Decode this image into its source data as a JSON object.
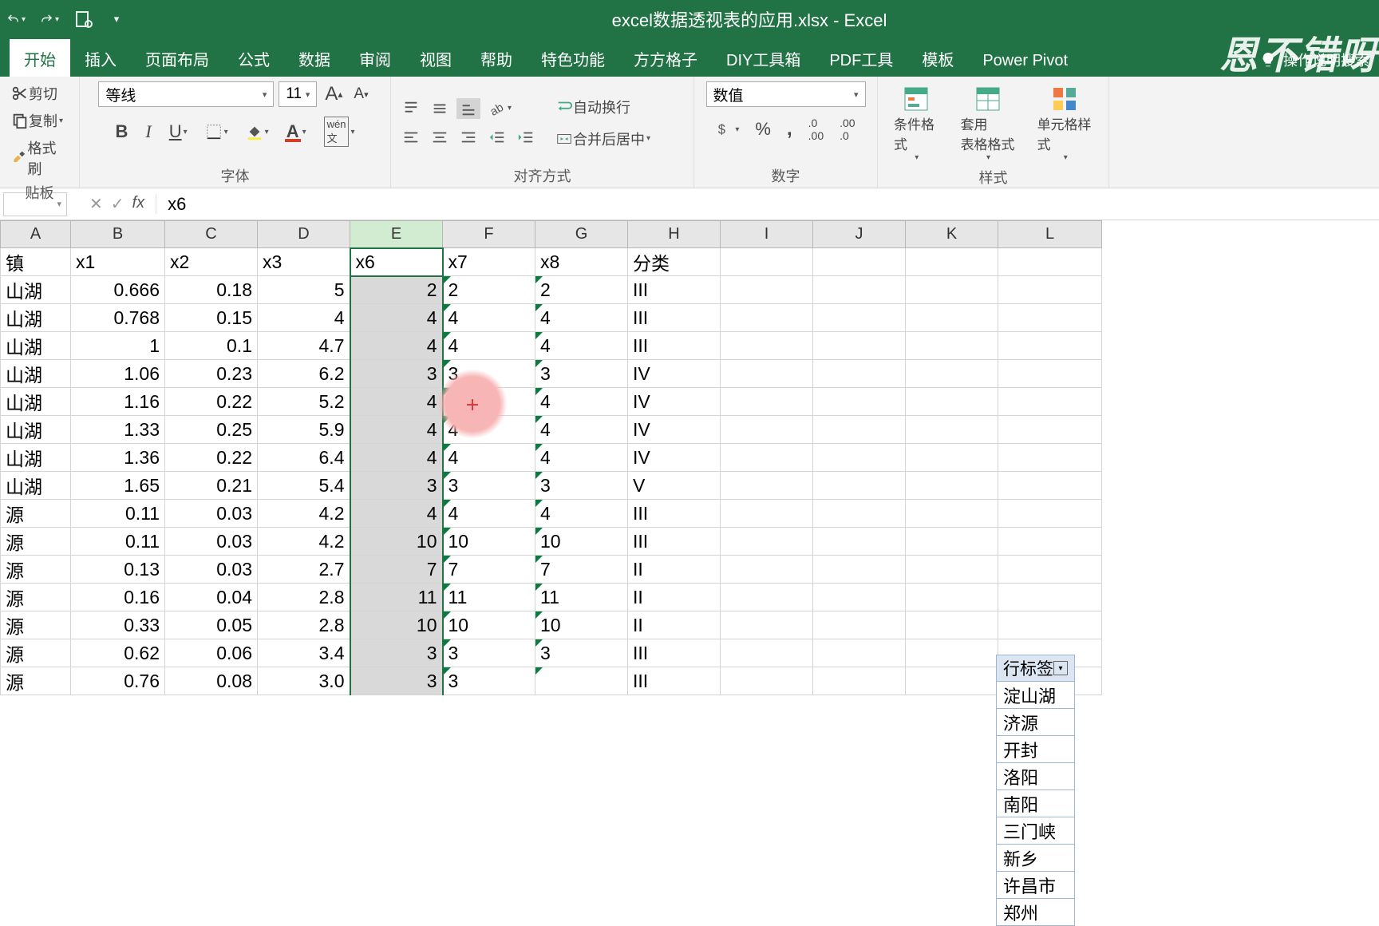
{
  "titlebar": {
    "title": "excel数据透视表的应用.xlsx - Excel"
  },
  "watermark": "恩不错呀",
  "tabs": [
    "开始",
    "插入",
    "页面布局",
    "公式",
    "数据",
    "审阅",
    "视图",
    "帮助",
    "特色功能",
    "方方格子",
    "DIY工具箱",
    "PDF工具",
    "模板",
    "Power Pivot"
  ],
  "tellme": "操作说明搜索",
  "ribbon": {
    "clipboard": {
      "label": "贴板",
      "cut": "剪切",
      "copy": "复制",
      "painter": "格式刷"
    },
    "font": {
      "label": "字体",
      "name": "等线",
      "size": "11"
    },
    "align": {
      "label": "对齐方式",
      "wrap": "自动换行",
      "merge": "合并后居中"
    },
    "number": {
      "label": "数字",
      "format": "数值"
    },
    "styles": {
      "label": "样式",
      "cond": "条件格式",
      "table": "套用\n表格格式",
      "cell": "单元格样式"
    }
  },
  "fx": {
    "value": "x6"
  },
  "columns": [
    "A",
    "B",
    "C",
    "D",
    "E",
    "F",
    "G",
    "H",
    "I",
    "J",
    "K",
    "L"
  ],
  "headerRow": {
    "A": "镇",
    "B": "x1",
    "C": "x2",
    "D": "x3",
    "E": "x6",
    "F": "x7",
    "G": "x8",
    "H": "分类"
  },
  "rows": [
    {
      "A": "山湖",
      "B": "0.666",
      "C": "0.18",
      "D": "5",
      "E": "2",
      "F": "2",
      "G": "2",
      "H": "III"
    },
    {
      "A": "山湖",
      "B": "0.768",
      "C": "0.15",
      "D": "4",
      "E": "4",
      "F": "4",
      "G": "4",
      "H": "III"
    },
    {
      "A": "山湖",
      "B": "1",
      "C": "0.1",
      "D": "4.7",
      "E": "4",
      "F": "4",
      "G": "4",
      "H": "III"
    },
    {
      "A": "山湖",
      "B": "1.06",
      "C": "0.23",
      "D": "6.2",
      "E": "3",
      "F": "3",
      "G": "3",
      "H": "IV"
    },
    {
      "A": "山湖",
      "B": "1.16",
      "C": "0.22",
      "D": "5.2",
      "E": "4",
      "F": "4",
      "G": "4",
      "H": "IV"
    },
    {
      "A": "山湖",
      "B": "1.33",
      "C": "0.25",
      "D": "5.9",
      "E": "4",
      "F": "4",
      "G": "4",
      "H": "IV"
    },
    {
      "A": "山湖",
      "B": "1.36",
      "C": "0.22",
      "D": "6.4",
      "E": "4",
      "F": "4",
      "G": "4",
      "H": "IV"
    },
    {
      "A": "山湖",
      "B": "1.65",
      "C": "0.21",
      "D": "5.4",
      "E": "3",
      "F": "3",
      "G": "3",
      "H": "V"
    },
    {
      "A": "源",
      "B": "0.11",
      "C": "0.03",
      "D": "4.2",
      "E": "4",
      "F": "4",
      "G": "4",
      "H": "III"
    },
    {
      "A": "源",
      "B": "0.11",
      "C": "0.03",
      "D": "4.2",
      "E": "10",
      "F": "10",
      "G": "10",
      "H": "III"
    },
    {
      "A": "源",
      "B": "0.13",
      "C": "0.03",
      "D": "2.7",
      "E": "7",
      "F": "7",
      "G": "7",
      "H": "II"
    },
    {
      "A": "源",
      "B": "0.16",
      "C": "0.04",
      "D": "2.8",
      "E": "11",
      "F": "11",
      "G": "11",
      "H": "II"
    },
    {
      "A": "源",
      "B": "0.33",
      "C": "0.05",
      "D": "2.8",
      "E": "10",
      "F": "10",
      "G": "10",
      "H": "II"
    },
    {
      "A": "源",
      "B": "0.62",
      "C": "0.06",
      "D": "3.4",
      "E": "3",
      "F": "3",
      "G": "3",
      "H": "III"
    },
    {
      "A": "源",
      "B": "0.76",
      "C": "0.08",
      "D": "3.0",
      "E": "3",
      "F": "3",
      "G": "",
      "H": "III"
    }
  ],
  "pivot": {
    "header": "行标签",
    "items": [
      "淀山湖",
      "济源",
      "开封",
      "洛阳",
      "南阳",
      "三门峡",
      "新乡",
      "许昌市",
      "郑州"
    ]
  }
}
